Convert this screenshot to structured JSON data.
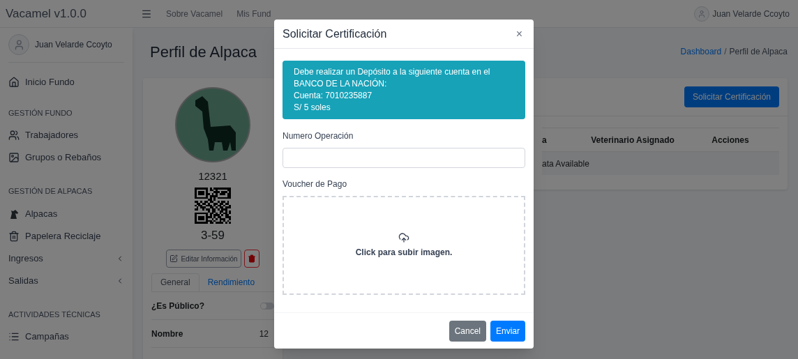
{
  "navbar": {
    "brand": "Vacamel v1.0.0",
    "links": [
      "Sobre Vacamel",
      "Mis Fund"
    ],
    "user": "Juan Velarde Ccoyto"
  },
  "sidebar": {
    "user": "Juan Velarde Ccoyto",
    "sections": [
      {
        "items": [
          {
            "label": "Inicio Fundo",
            "kind": "home"
          }
        ]
      },
      {
        "heading": "GESTIÓN FUNDO",
        "items": [
          {
            "label": "Trabajadores",
            "kind": "users"
          },
          {
            "label": "Grupos o Rebaños",
            "kind": "groups"
          }
        ]
      },
      {
        "heading": "GESTIÓN DE ALPACAS",
        "items": [
          {
            "label": "Alpacas",
            "kind": "alpaca"
          },
          {
            "label": "Papelera Reciclaje",
            "kind": "trash"
          },
          {
            "label": "Ingresos",
            "kind": "menu",
            "expanded": false
          },
          {
            "label": "Salidas",
            "kind": "menu",
            "expanded": false
          }
        ]
      },
      {
        "heading": "ACTIVIDADES TÉCNICAS",
        "items": [
          {
            "label": "Campañas",
            "kind": "list"
          }
        ]
      }
    ]
  },
  "page": {
    "title": "Perfil de Alpaca",
    "breadcrumb_separator": "/",
    "breadcrumb": [
      {
        "label": "Dashboard",
        "link": true
      },
      {
        "label": "Perfil de Alpaca",
        "link": false
      }
    ]
  },
  "profile": {
    "code": "12321",
    "qr_label": "3-59",
    "edit_button": "Editar Información",
    "tabs": [
      {
        "label": "General",
        "selected": true
      },
      {
        "label": "Rendimiento",
        "selected": false
      }
    ],
    "fields": [
      {
        "label": "¿Es Público?",
        "kind": "toggle",
        "on": false
      },
      {
        "label": "Nombre",
        "kind": "text",
        "value": "12"
      }
    ]
  },
  "certifications": {
    "button": "Solicitar Certificación",
    "columns": [
      "a",
      "Veterinario Asignado",
      "Acciones"
    ],
    "empty": "ata Available"
  },
  "modal": {
    "title": "Solicitar Certificación",
    "close": "×",
    "alert": [
      "Debe realizar un Depósito a la siguiente cuenta en el",
      "BANCO DE LA NACIÓN:",
      "Cuenta: 7010235887",
      "S/ 5 soles"
    ],
    "operation_label": "Numero Operación",
    "voucher_label": "Voucher de Pago",
    "upload_text": "Click para subir imagen.",
    "buttons": [
      {
        "label": "Cancel",
        "kind": "secondary"
      },
      {
        "label": "Enviar",
        "kind": "primary"
      }
    ]
  }
}
